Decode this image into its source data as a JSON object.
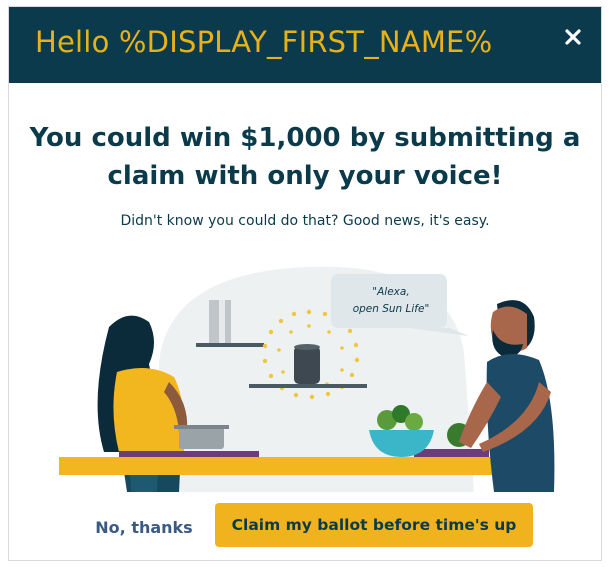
{
  "header": {
    "title": "Hello %DISPLAY_FIRST_NAME%",
    "close_icon": "close-icon"
  },
  "main": {
    "headline_line1": "You could win $1,000 by submitting a",
    "headline_line2": "claim with only your voice!",
    "subtext": "Didn't know you could do that? Good news, it's easy.",
    "speech_bubble_line1": "\"Alexa,",
    "speech_bubble_line2": "open Sun Life\""
  },
  "actions": {
    "decline_label": "No, thanks",
    "claim_label": "Claim my ballot before time's up"
  },
  "colors": {
    "header_bg": "#0a3a4b",
    "header_text": "#e8b117",
    "headline": "#0b3a4b",
    "cta_bg": "#f0b31d",
    "link": "#3a5a86"
  }
}
